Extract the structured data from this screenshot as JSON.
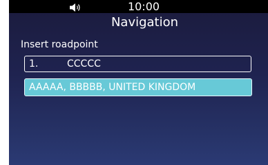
{
  "status_bar": {
    "volume_icon": "speaker-volume-icon",
    "time": "10:00"
  },
  "header": {
    "title": "Navigation",
    "subtitle": "Insert roadpoint"
  },
  "roadpoints": [
    {
      "index": "1.",
      "name": "CCCCC"
    }
  ],
  "suggestions": [
    {
      "label": "AAAAA, BBBBB, UNITED KINGDOM",
      "selected": true
    }
  ],
  "colors": {
    "status_bar_bg": "#000000",
    "screen_gradient_top": "#1b1b3c",
    "screen_gradient_bottom": "#2b3a74",
    "highlight": "#67c9d7",
    "text": "#ffffff"
  }
}
